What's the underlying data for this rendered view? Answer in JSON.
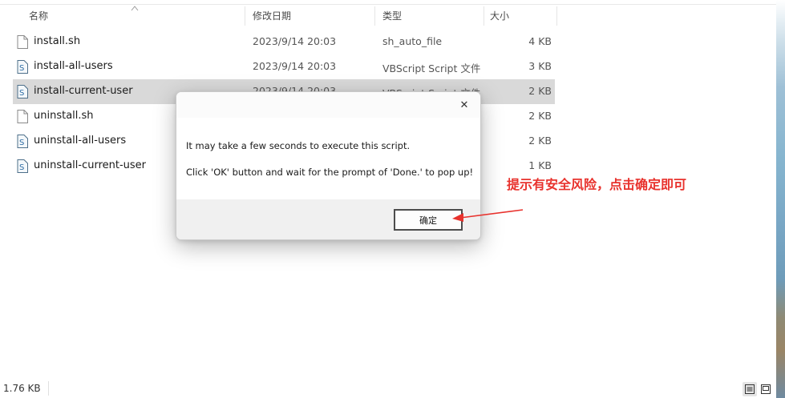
{
  "columns": {
    "name": "名称",
    "modified": "修改日期",
    "type": "类型",
    "size": "大小"
  },
  "files": [
    {
      "name": "install.sh",
      "date": "2023/9/14 20:03",
      "type": "sh_auto_file",
      "size": "4 KB",
      "icon": "blank-file-icon"
    },
    {
      "name": "install-all-users",
      "date": "2023/9/14 20:03",
      "type": "VBScript Script 文件",
      "size": "3 KB",
      "icon": "vbscript-file-icon"
    },
    {
      "name": "install-current-user",
      "date": "2023/9/14 20:03",
      "type": "VBScript Script 文件",
      "size": "2 KB",
      "icon": "vbscript-file-icon",
      "selected": true
    },
    {
      "name": "uninstall.sh",
      "date": "",
      "type": "",
      "size": "2 KB",
      "icon": "blank-file-icon"
    },
    {
      "name": "uninstall-all-users",
      "date": "",
      "type": "",
      "size": "2 KB",
      "icon": "vbscript-file-icon"
    },
    {
      "name": "uninstall-current-user",
      "date": "",
      "type": "",
      "size": "1 KB",
      "icon": "vbscript-file-icon"
    }
  ],
  "dialog": {
    "message1": "It may take a few seconds to execute this script.",
    "message2": "Click 'OK' button and wait for the prompt of 'Done.' to pop up!",
    "ok_label": "确定",
    "close_glyph": "✕"
  },
  "annotation": {
    "text": "提示有安全风险，点击确定即可",
    "color": "#e8322d"
  },
  "status": {
    "selection_size": "1.76 KB"
  },
  "colors": {
    "selected_row": "#d9d9d9",
    "dialog_footer": "#f0f0f0"
  }
}
